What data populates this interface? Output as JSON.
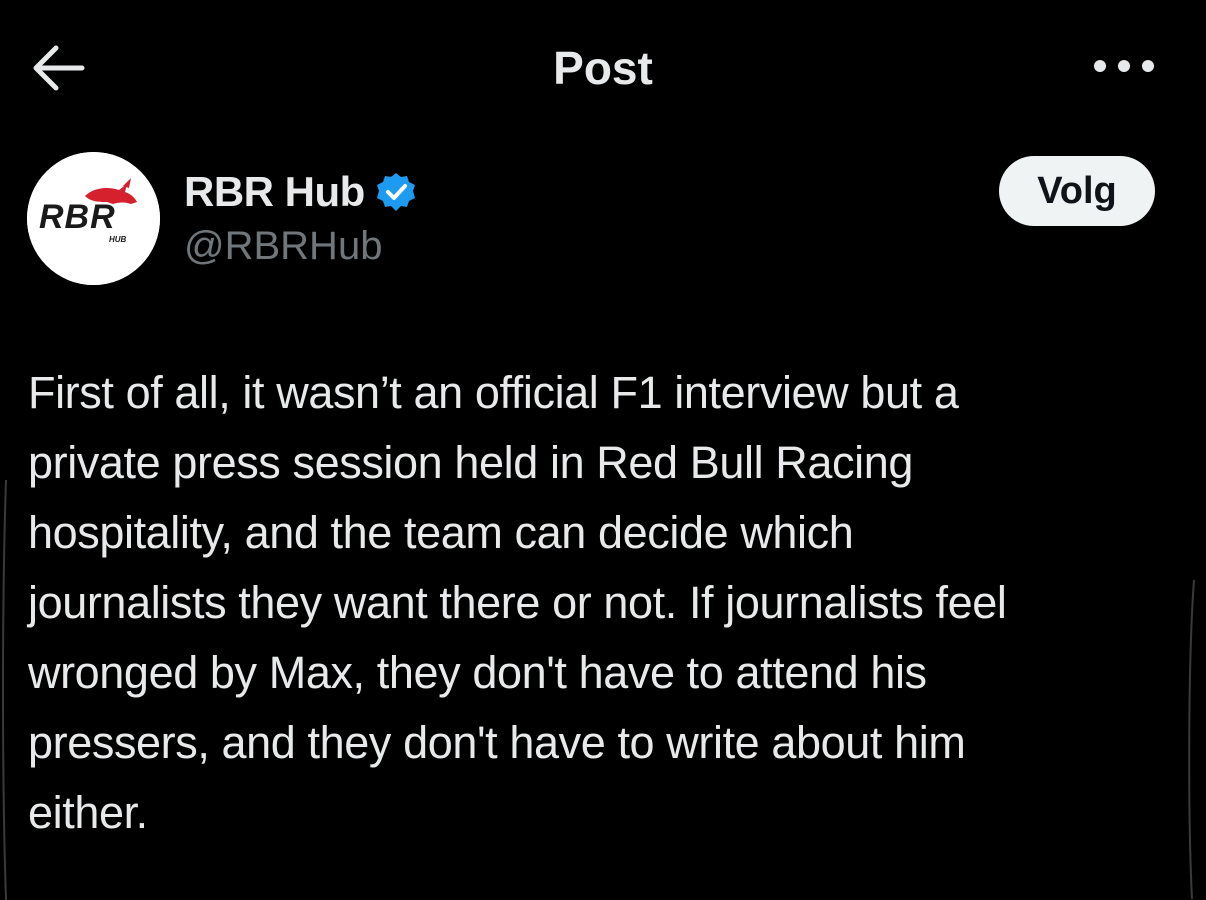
{
  "header": {
    "title": "Post",
    "back_icon": "arrow-left-icon",
    "more_icon": "more-horizontal-icon"
  },
  "author": {
    "name": "RBR Hub",
    "handle": "@RBRHub",
    "verified_icon": "verified-badge-icon",
    "avatar_logo_text": "RBR",
    "avatar_logo_sub": "HUB",
    "follow_label": "Volg"
  },
  "post": {
    "lines": [
      "First of all, it wasn’t an official F1 interview but a",
      "private press session held in Red Bull Racing",
      "hospitality, and the team can decide which",
      "journalists they want there or not. If journalists feel",
      "wronged by Max, they don't have to attend his",
      "pressers, and they don't have to write about him",
      "either."
    ]
  },
  "colors": {
    "background": "#000000",
    "text_primary": "#e7e9ea",
    "text_secondary": "#71767b",
    "verified_blue": "#1d9bf0",
    "follow_bg": "#eff3f4",
    "logo_red": "#d5202e"
  }
}
